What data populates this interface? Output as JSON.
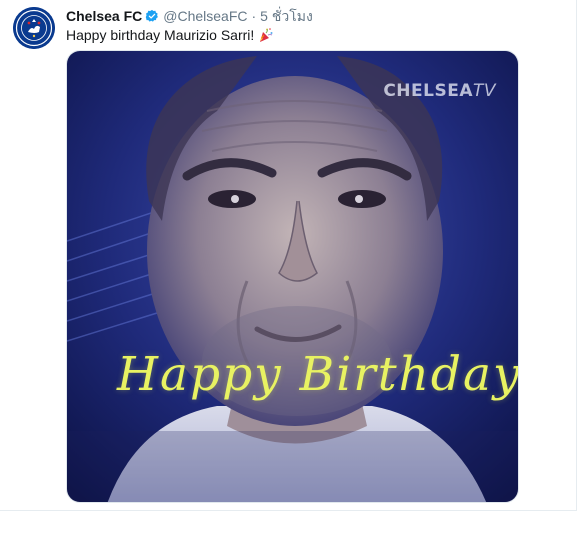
{
  "tweet": {
    "display_name": "Chelsea FC",
    "handle": "@ChelseaFC",
    "separator": "·",
    "timestamp": "5 ชั่วโมง",
    "text": "Happy birthday Maurizio Sarri!",
    "verified_icon": "verified-badge-icon",
    "emoji_icon": "party-popper-icon"
  },
  "avatar": {
    "icon": "chelsea-crest-icon",
    "color": "#0a3a8f"
  },
  "media": {
    "watermark_brand": "CHELSEA",
    "watermark_suffix": "TV",
    "overlay_text": "Happy Birthday",
    "overlay_color": "#e8f262"
  }
}
